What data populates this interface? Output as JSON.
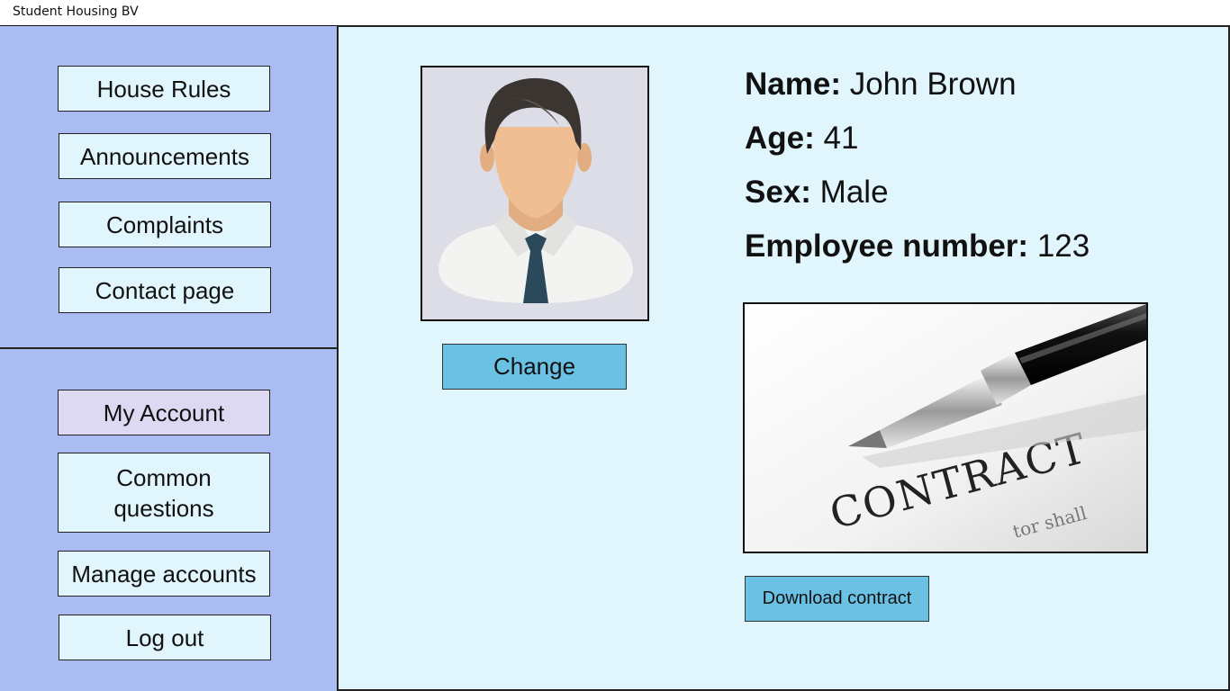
{
  "window": {
    "title": "Student Housing BV"
  },
  "sidebar": {
    "top_items": [
      {
        "label": "House Rules"
      },
      {
        "label": "Announcements"
      },
      {
        "label": "Complaints"
      },
      {
        "label": "Contact page"
      }
    ],
    "bottom_items": [
      {
        "label": "My Account",
        "active": true
      },
      {
        "label": "Common questions"
      },
      {
        "label": "Manage accounts"
      },
      {
        "label": "Log out"
      }
    ]
  },
  "profile": {
    "photo_icon": "avatar-man-with-tie",
    "change_label": "Change",
    "name_label": "Name:",
    "name_value": "John Brown",
    "age_label": "Age:",
    "age_value": "41",
    "sex_label": "Sex:",
    "sex_value": "Male",
    "employee_label": "Employee number:",
    "employee_value": "123"
  },
  "contract": {
    "image_word": "CONTRACT",
    "image_small_text": "tor shall",
    "download_label": "Download contract"
  },
  "colors": {
    "sidebar_bg": "#aabcf1",
    "main_bg": "#e1f5fd",
    "button_blue": "#6bc1e3",
    "active_item": "#ddd9f2"
  }
}
